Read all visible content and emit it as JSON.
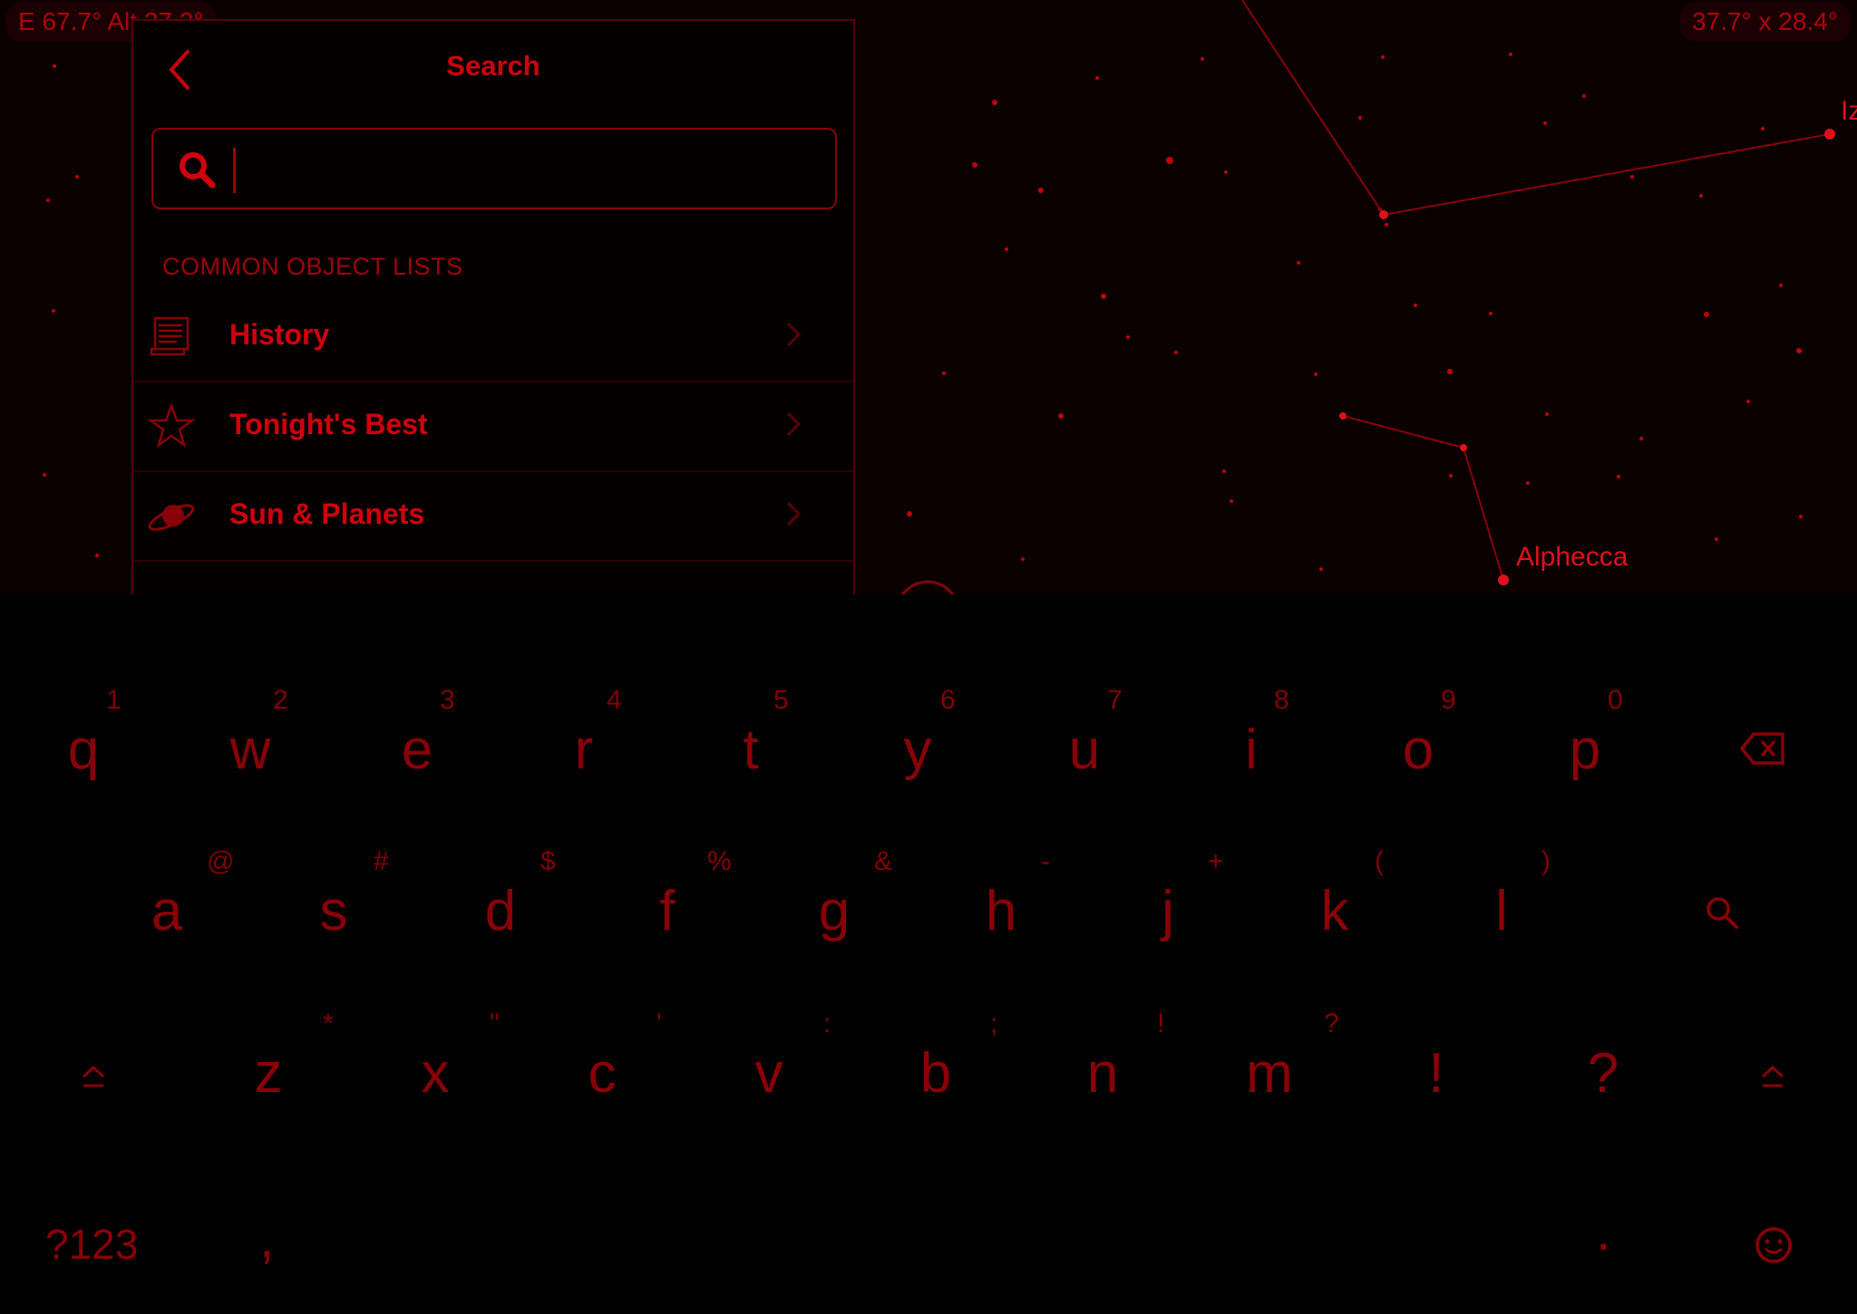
{
  "hud": {
    "position": "E 67.7° Alt 27.2°",
    "fov": "37.7° x 28.4°"
  },
  "sky_labels": {
    "alphecca": "Alphecca",
    "partial_right": "Iz"
  },
  "panel": {
    "title": "Search",
    "search": {
      "value": "",
      "placeholder": ""
    },
    "section_label": "COMMON OBJECT LISTS",
    "items": [
      {
        "label": "History",
        "icon": "scroll-icon"
      },
      {
        "label": "Tonight's Best",
        "icon": "star-icon"
      },
      {
        "label": "Sun & Planets",
        "icon": "planet-icon"
      }
    ]
  },
  "keyboard": {
    "row1": {
      "keys": [
        "q",
        "w",
        "e",
        "r",
        "t",
        "y",
        "u",
        "i",
        "o",
        "p"
      ],
      "hints": [
        "1",
        "2",
        "3",
        "4",
        "5",
        "6",
        "7",
        "8",
        "9",
        "0"
      ]
    },
    "row2": {
      "keys": [
        "a",
        "s",
        "d",
        "f",
        "g",
        "h",
        "j",
        "k",
        "l"
      ],
      "hints": [
        "@",
        "#",
        "$",
        "%",
        "&",
        "-",
        "+",
        "(",
        ")"
      ]
    },
    "row3": {
      "keys": [
        "z",
        "x",
        "c",
        "v",
        "b",
        "n",
        "m",
        "!",
        "?"
      ],
      "hints": [
        "*",
        "\"",
        "'",
        ":",
        ";",
        "!",
        "?",
        "",
        ""
      ]
    },
    "symbols_label": "?123",
    "comma": ",",
    "period": ".",
    "backspace_icon": "backspace-icon",
    "search_icon": "search-key-icon",
    "shift_icon": "shift-icon",
    "emoji_icon": "emoji-icon"
  },
  "colors": {
    "accent": "#d0000c",
    "background": "#000000",
    "sky": "#0a0000"
  }
}
